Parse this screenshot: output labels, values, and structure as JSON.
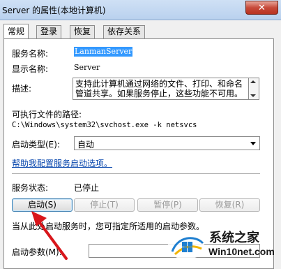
{
  "window": {
    "title": "Server 的属性(本地计算机)",
    "close_glyph": "✕"
  },
  "tabs": [
    {
      "label": "常规",
      "active": true
    },
    {
      "label": "登录",
      "active": false
    },
    {
      "label": "恢复",
      "active": false
    },
    {
      "label": "依存关系",
      "active": false
    }
  ],
  "general": {
    "service_name_label": "服务名称:",
    "service_name": "LanmanServer",
    "display_name_label": "显示名称:",
    "display_name": "Server",
    "description_label": "描述:",
    "description": "支持此计算机通过网络的文件、打印、和命名管道共享。如果服务停止，这些功能不可用。",
    "exe_path_label": "可执行文件的路径:",
    "exe_path": "C:\\Windows\\system32\\svchost.exe -k netsvcs",
    "startup_type_label": "启动类型(E):",
    "startup_type_value": "自动",
    "help_link": "帮助我配置服务启动选项。",
    "status_label": "服务状态:",
    "status_value": "已停止",
    "start_params_note": "当从此处启动服务时，您可指定所适用的启动参数。",
    "start_params_label": "启动参数(M):",
    "start_params_value": ""
  },
  "buttons": {
    "start": "启动(S)",
    "stop": "停止(T)",
    "pause": "暂停(P)",
    "resume": "恢复(R)"
  },
  "watermark": {
    "line1": "系统之家",
    "line2": "Win10net.com"
  },
  "colors": {
    "selection": "#3399ff",
    "link": "#0645ad",
    "close": "#c74a3a"
  }
}
